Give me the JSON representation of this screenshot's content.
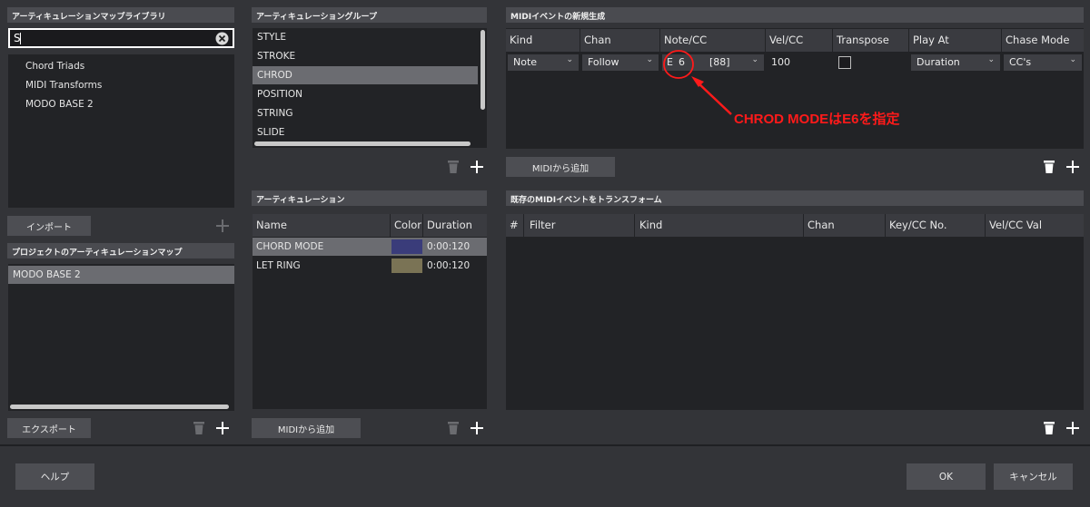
{
  "library": {
    "header": "アーティキュレーションマップライブラリ",
    "search_value": "S",
    "items": [
      "Chord Triads",
      "MIDI Transforms",
      "MODO BASE 2"
    ],
    "import_label": "インポート"
  },
  "project_map": {
    "header": "プロジェクトのアーティキュレーションマップ",
    "items": [
      "MODO BASE 2"
    ],
    "export_label": "エクスポート"
  },
  "groups": {
    "header": "アーティキュレーショングループ",
    "items": [
      "STYLE",
      "STROKE",
      "CHROD",
      "POSITION",
      "STRING",
      "SLIDE"
    ],
    "selected_index": 2
  },
  "articulations": {
    "header": "アーティキュレーション",
    "columns": [
      "Name",
      "Color",
      "Duration"
    ],
    "rows": [
      {
        "name": "CHORD MODE",
        "color": "#3a3c7a",
        "duration": "0:00:120"
      },
      {
        "name": "LET RING",
        "color": "#7a7355",
        "duration": "0:00:120"
      }
    ],
    "add_midi_label": "MIDIから追加"
  },
  "midi_new": {
    "header": "MIDIイベントの新規生成",
    "columns": [
      "Kind",
      "Chan",
      "Note/CC",
      "Vel/CC",
      "Transpose",
      "Play At",
      "Chase Mode"
    ],
    "row": {
      "kind": "Note",
      "chan": "Follow",
      "note_letter": "E",
      "note_octave": "6",
      "note_number": "[88]",
      "vel": "100",
      "play_at": "Duration",
      "chase_mode": "CC's"
    },
    "add_midi_label": "MIDIから追加"
  },
  "annotation": {
    "text": "CHROD MODEはE6を指定",
    "color": "#ff1a1a"
  },
  "transform": {
    "header": "既存のMIDIイベントをトランスフォーム",
    "columns": [
      "#",
      "Filter",
      "Kind",
      "Chan",
      "Key/CC No.",
      "Vel/CC Val"
    ]
  },
  "footer": {
    "help_label": "ヘルプ",
    "ok_label": "OK",
    "cancel_label": "キャンセル"
  },
  "icons": {
    "plus": "plus-icon",
    "trash": "trash-icon",
    "clear": "clear-circle-icon",
    "chevron": "chevron-down-icon"
  }
}
